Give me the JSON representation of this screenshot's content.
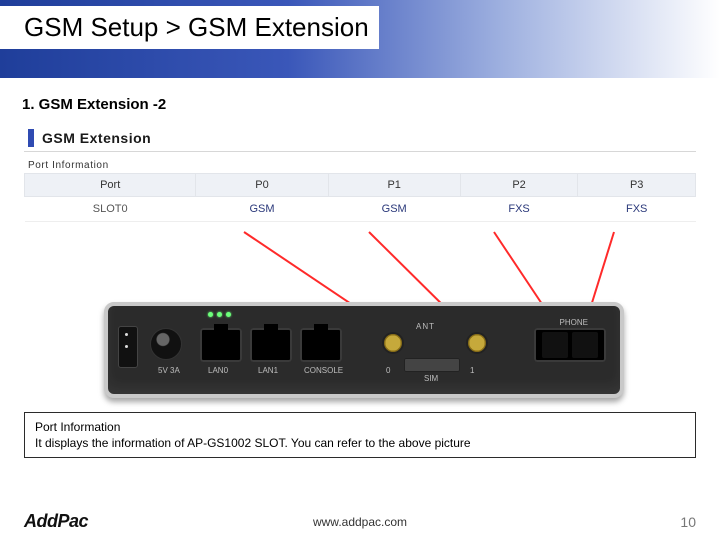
{
  "title": "GSM Setup > GSM Extension",
  "subheading": "1. GSM Extension -2",
  "panel": {
    "heading": "GSM Extension",
    "section_label": "Port Information",
    "table": {
      "headers": [
        "Port",
        "P0",
        "P1",
        "P2",
        "P3"
      ],
      "rows": [
        [
          "SLOT0",
          "GSM",
          "GSM",
          "FXS",
          "FXS"
        ]
      ]
    }
  },
  "device": {
    "power_label": "5V 3A",
    "lan0": "LAN0",
    "lan1": "LAN1",
    "console": "CONSOLE",
    "ant": "ANT",
    "sim": "SIM",
    "num0": "0",
    "num1": "1",
    "phone": "PHONE"
  },
  "callout": {
    "line1": "Port Information",
    "line2": "It displays the information of AP-GS1002 SLOT. You can refer to the above picture"
  },
  "footer": {
    "brand": "AddPac",
    "url": "www.addpac.com",
    "page": "10"
  }
}
